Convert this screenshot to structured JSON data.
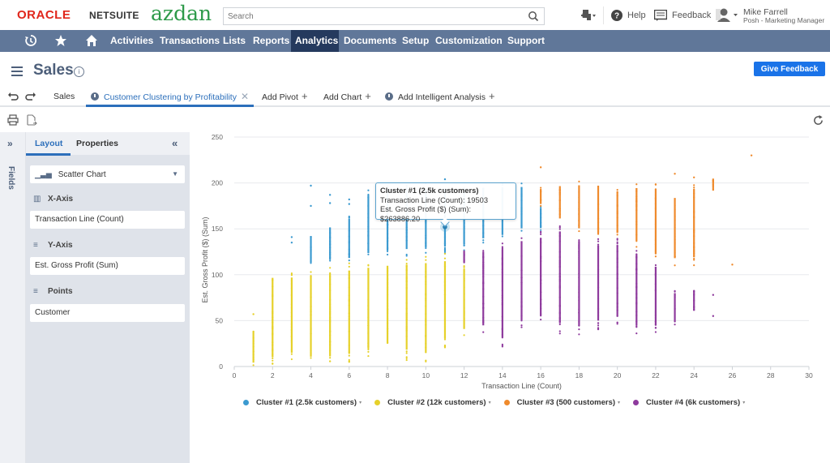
{
  "topbar": {
    "logo_oracle": "ORACLE",
    "logo_netsuite": "NETSUITE",
    "brand": "azdan",
    "search_placeholder": "Search",
    "help_label": "Help",
    "feedback_label": "Feedback",
    "user_name": "Mike Farrell",
    "user_role": "Posh - Marketing Manager"
  },
  "navbar": {
    "items": [
      "Activities",
      "Transactions",
      "Lists",
      "Reports",
      "Analytics",
      "Documents",
      "Setup",
      "Customization",
      "Support"
    ],
    "active": "Analytics"
  },
  "page": {
    "title": "Sales",
    "give_feedback_label": "Give Feedback"
  },
  "tabs": {
    "sales": "Sales",
    "active_tab": "Customer Clustering by Profitability",
    "add_pivot": "Add Pivot",
    "add_chart": "Add Chart",
    "add_intelligent": "Add Intelligent Analysis"
  },
  "fields_strip": {
    "label": "Fields"
  },
  "panel": {
    "tab_layout": "Layout",
    "tab_properties": "Properties",
    "chart_type": "Scatter Chart",
    "x_axis_label": "X-Axis",
    "x_axis_value": "Transaction Line (Count)",
    "y_axis_label": "Y-Axis",
    "y_axis_value": "Est. Gross Profit (Sum)",
    "points_label": "Points",
    "points_value": "Customer"
  },
  "tooltip": {
    "title": "Cluster #1 (2.5k customers)",
    "line1": "Transaction Line (Count): 19503",
    "line2": "Est. Gross Profit ($) (Sum): $263886.20"
  },
  "chart_data": {
    "type": "scatter",
    "title": "",
    "xlabel": "Transaction Line (Count)",
    "ylabel": "Est. Gross Profit ($) (Sum)",
    "xlim": [
      0,
      30
    ],
    "ylim": [
      0,
      250
    ],
    "xticks": [
      0,
      2,
      4,
      6,
      8,
      10,
      12,
      14,
      16,
      18,
      20,
      22,
      24,
      26,
      28,
      30
    ],
    "yticks": [
      0,
      50,
      100,
      150,
      200,
      250
    ],
    "grid": true,
    "legend_position": "bottom",
    "highlighted_point": {
      "series": "Cluster #1 (2.5k customers)",
      "x": 11,
      "y": 152
    },
    "series": [
      {
        "name": "Cluster #1 (2.5k customers)",
        "color": "#3b9ad0",
        "ranges": [
          [
            4,
            110,
            145
          ],
          [
            5,
            112,
            155
          ],
          [
            6,
            113,
            165
          ],
          [
            7,
            116,
            193
          ],
          [
            8,
            118,
            200
          ],
          [
            9,
            120,
            200
          ],
          [
            10,
            122,
            200
          ],
          [
            11,
            123,
            200
          ],
          [
            12,
            126,
            200
          ],
          [
            13,
            133,
            200
          ],
          [
            14,
            137,
            200
          ],
          [
            15,
            145,
            200
          ],
          [
            16,
            148,
            175
          ]
        ],
        "points": [
          [
            3,
            135
          ],
          [
            3,
            141
          ],
          [
            4,
            175
          ],
          [
            4,
            197
          ],
          [
            5,
            178
          ],
          [
            5,
            187
          ],
          [
            6,
            177
          ],
          [
            6,
            182
          ],
          [
            11,
            204
          ]
        ]
      },
      {
        "name": "Cluster #2 (12k customers)",
        "color": "#e6d12a",
        "ranges": [
          [
            1,
            0,
            42
          ],
          [
            2,
            0,
            105
          ],
          [
            3,
            5,
            105
          ],
          [
            4,
            0,
            107
          ],
          [
            5,
            0,
            110
          ],
          [
            6,
            5,
            113
          ],
          [
            7,
            10,
            116
          ],
          [
            8,
            15,
            118
          ],
          [
            9,
            7,
            120
          ],
          [
            10,
            5,
            122
          ],
          [
            11,
            20,
            123
          ],
          [
            12,
            33,
            112
          ]
        ],
        "points": [
          [
            1,
            57
          ]
        ]
      },
      {
        "name": "Cluster #3 (500 customers)",
        "color": "#ef8a2c",
        "ranges": [
          [
            16,
            175,
            195
          ],
          [
            17,
            157,
            200
          ],
          [
            18,
            145,
            202
          ],
          [
            19,
            140,
            202
          ],
          [
            20,
            140,
            195
          ],
          [
            21,
            130,
            200
          ],
          [
            22,
            115,
            200
          ],
          [
            23,
            110,
            190
          ],
          [
            24,
            110,
            200
          ],
          [
            25,
            190,
            206
          ]
        ],
        "points": [
          [
            16,
            217
          ],
          [
            23,
            210
          ],
          [
            24,
            206
          ],
          [
            26,
            111
          ],
          [
            27,
            230
          ]
        ]
      },
      {
        "name": "Cluster #4 (6k customers)",
        "color": "#8e3a9d",
        "ranges": [
          [
            12,
            112,
            126
          ],
          [
            13,
            35,
            133
          ],
          [
            14,
            20,
            137
          ],
          [
            15,
            40,
            145
          ],
          [
            16,
            45,
            148
          ],
          [
            17,
            35,
            157
          ],
          [
            18,
            33,
            145
          ],
          [
            19,
            40,
            140
          ],
          [
            20,
            45,
            140
          ],
          [
            21,
            35,
            130
          ],
          [
            22,
            37,
            115
          ],
          [
            23,
            45,
            83
          ],
          [
            24,
            58,
            85
          ]
        ],
        "points": [
          [
            25,
            55
          ],
          [
            25,
            78
          ]
        ]
      }
    ]
  }
}
